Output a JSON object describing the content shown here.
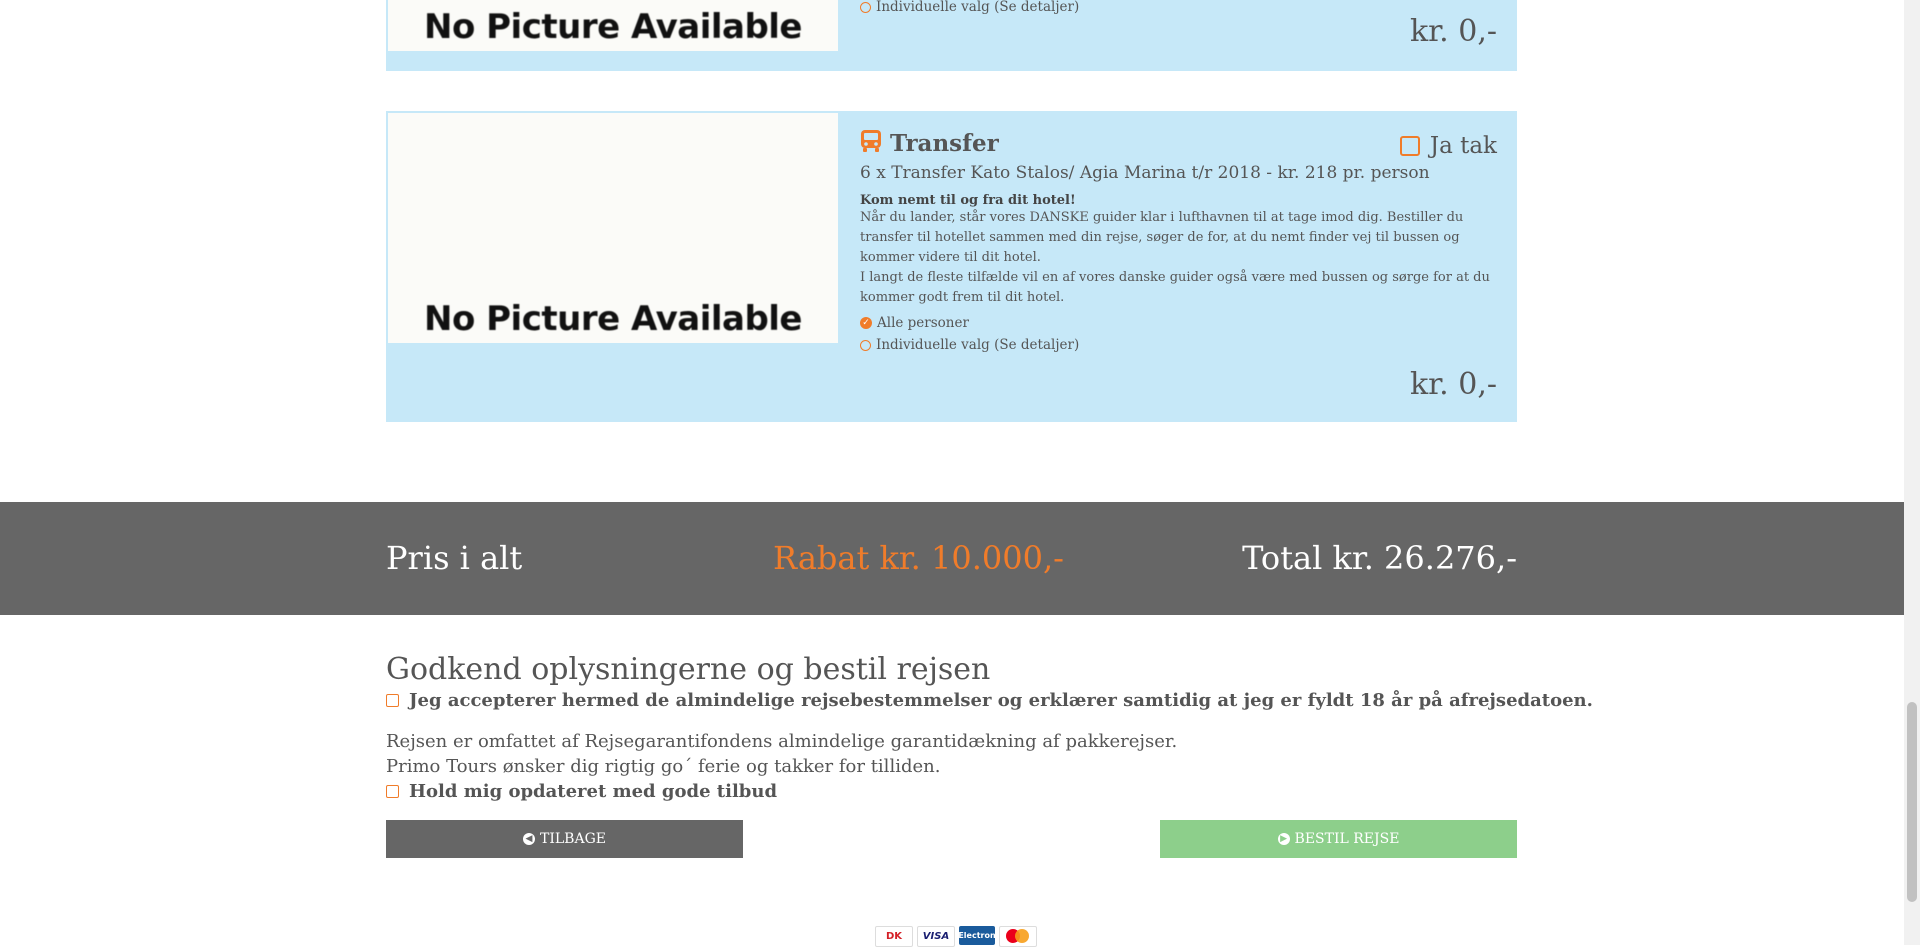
{
  "cards": [
    {
      "image_text": "No Picture Available",
      "option": "Individuelle valg (Se detaljer)",
      "price": "kr. 0,-"
    },
    {
      "image_text": "No Picture Available",
      "icon": "bus-icon",
      "title": "Transfer",
      "opt_in_label": "Ja tak",
      "subtitle": "6 x Transfer Kato Stalos/ Agia Marina t/r 2018 - kr. 218 pr. person",
      "desc_head": "Kom nemt til og fra dit hotel!",
      "desc_p1": "Når du lander, står vores DANSKE guider klar i lufthavnen til at tage imod dig. Bestiller du transfer til hotellet sammen med din rejse, søger de for, at du nemt finder vej til bussen og kommer videre til dit hotel.",
      "desc_p2": "I langt de fleste tilfælde vil en af vores danske guider også være med bussen og sørge for at du kommer godt frem til dit hotel.",
      "option_all": "Alle personer",
      "option_individual": "Individuelle valg (Se detaljer)",
      "price": "kr. 0,-"
    }
  ],
  "totals": {
    "label": "Pris i alt",
    "discount": "Rabat kr. 10.000,-",
    "total": "Total kr. 26.276,-"
  },
  "approve": {
    "title": "Godkend oplysningerne og bestil rejsen",
    "accept_terms": "Jeg accepterer hermed de almindelige rejsebestemmelser og erklærer samtidig at jeg er fyldt 18 år på afrejsedatoen.",
    "guarantee": "Rejsen er omfattet af Rejsegarantifondens almindelige garantidækning af pakkerejser.",
    "thanks": "Primo Tours ønsker dig rigtig go´ ferie og takker for tilliden.",
    "newsletter": "Hold mig opdateret med gode tilbud"
  },
  "buttons": {
    "back": "TILBAGE",
    "order": "BESTIL REJSE"
  },
  "payments": {
    "dk": "DK",
    "visa": "VISA",
    "electron": "Electron"
  },
  "colors": {
    "card_bg": "#c6e8f8",
    "accent": "#f07c2a",
    "band": "#666666",
    "order_button": "#8dcf8b"
  }
}
